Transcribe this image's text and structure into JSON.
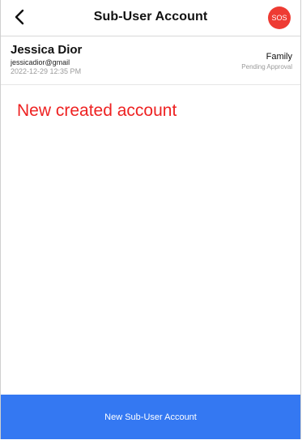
{
  "header": {
    "title": "Sub-User Account",
    "back_icon": "chevron-left-icon",
    "sos_label": "SOS"
  },
  "account": {
    "name": "Jessica Dior",
    "email": "jessicadior@gmail",
    "timestamp": "2022-12-29 12:35 PM",
    "relationship": "Family",
    "status": "Pending Approval"
  },
  "annotation": {
    "text": "New created account"
  },
  "footer": {
    "button_label": "New Sub-User Account"
  },
  "colors": {
    "accent_blue": "#3478f2",
    "sos_red": "#ee3b33",
    "annotation_red": "#ee2222",
    "muted_gray": "#9a9a9a"
  }
}
